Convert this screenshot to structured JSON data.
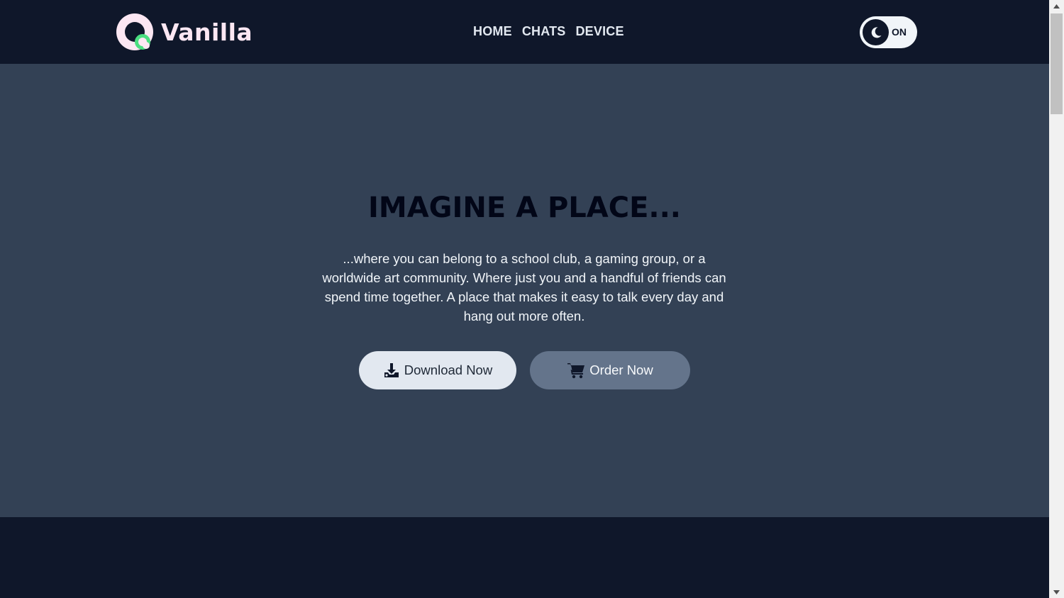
{
  "brand": {
    "name": "Vanilla",
    "ring_color": "#fce7f3",
    "dot_color": "#4ade80"
  },
  "nav": {
    "items": [
      {
        "label": "HOME"
      },
      {
        "label": "CHATS"
      },
      {
        "label": "DEVICE"
      }
    ]
  },
  "theme_toggle": {
    "icon": "moon-icon",
    "state_label": "ON"
  },
  "hero": {
    "title": "IMAGINE A PLACE...",
    "description": "...where you can belong to a school club, a gaming group, or a worldwide art community. Where just you and a handful of friends can spend time together. A place that makes it easy to talk every day and hang out more often.",
    "primary_button": {
      "label": "Download Now",
      "icon": "download-icon"
    },
    "secondary_button": {
      "label": "Order Now",
      "icon": "cart-icon"
    }
  },
  "colors": {
    "header_bg": "#0f172a",
    "hero_bg": "#334155",
    "primary_button_bg": "#e2e8f0",
    "secondary_button_bg": "#64748b"
  }
}
